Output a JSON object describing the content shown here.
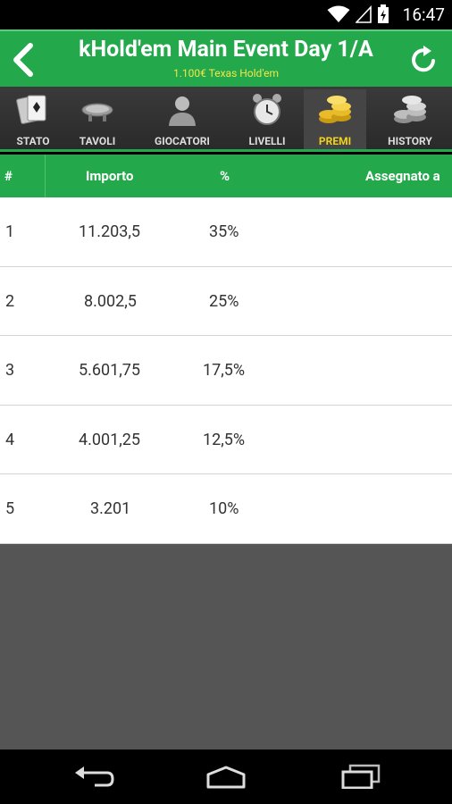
{
  "status": {
    "time": "16:47"
  },
  "header": {
    "title": "kHold'em Main Event Day 1/A",
    "subtitle": "1.100€ Texas Hold'em"
  },
  "tabs": [
    {
      "label": "STATO",
      "icon": "cards-icon",
      "active": false
    },
    {
      "label": "TAVOLI",
      "icon": "table-icon",
      "active": false
    },
    {
      "label": "GIOCATORI",
      "icon": "player-icon",
      "active": false
    },
    {
      "label": "LIVELLI",
      "icon": "clock-icon",
      "active": false
    },
    {
      "label": "PREMI",
      "icon": "gold-coins-icon",
      "active": true
    },
    {
      "label": "HISTORY",
      "icon": "silver-coins-icon",
      "active": false
    }
  ],
  "table": {
    "headers": {
      "rank": "#",
      "amount": "Importo",
      "percent": "%",
      "assigned": "Assegnato a"
    },
    "rows": [
      {
        "rank": "1",
        "amount": "11.203,5",
        "percent": "35%",
        "assigned": ""
      },
      {
        "rank": "2",
        "amount": "8.002,5",
        "percent": "25%",
        "assigned": ""
      },
      {
        "rank": "3",
        "amount": "5.601,75",
        "percent": "17,5%",
        "assigned": ""
      },
      {
        "rank": "4",
        "amount": "4.001,25",
        "percent": "12,5%",
        "assigned": ""
      },
      {
        "rank": "5",
        "amount": "3.201",
        "percent": "10%",
        "assigned": ""
      }
    ]
  },
  "colors": {
    "accent": "#23a84b",
    "subtitle": "#f1e64a",
    "active_tab": "#f3d21c"
  }
}
